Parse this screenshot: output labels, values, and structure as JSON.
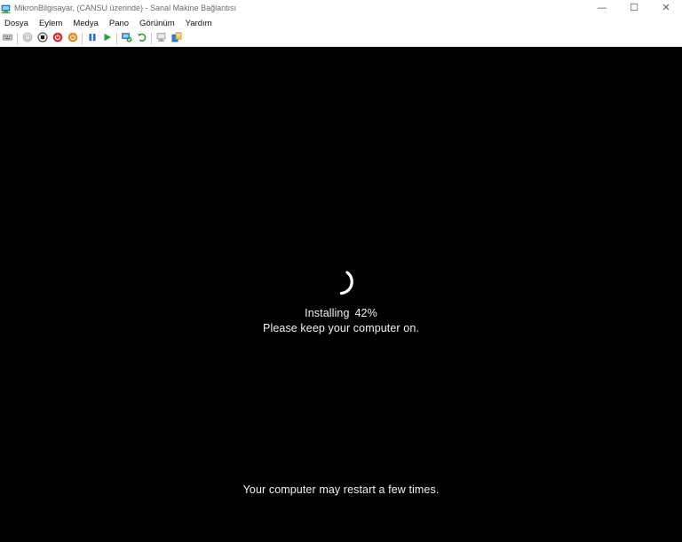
{
  "window": {
    "title": "MikronBilgisayar, (CANSU üzerinde) - Sanal Makine Bağlantısı",
    "controls": {
      "minimize": "—",
      "maximize": "☐",
      "close": "✕"
    }
  },
  "menu": {
    "items": [
      {
        "label": "Dosya"
      },
      {
        "label": "Eylem"
      },
      {
        "label": "Medya"
      },
      {
        "label": "Pano"
      },
      {
        "label": "Görünüm"
      },
      {
        "label": "Yardım"
      }
    ]
  },
  "toolbar": {
    "buttons": [
      {
        "icon": "ctrl-alt-del-icon"
      },
      {
        "icon": "start-icon"
      },
      {
        "icon": "turn-off-icon"
      },
      {
        "icon": "shut-down-icon"
      },
      {
        "icon": "save-state-icon"
      },
      {
        "icon": "pause-icon"
      },
      {
        "icon": "resume-icon"
      },
      {
        "icon": "checkpoint-icon"
      },
      {
        "icon": "revert-icon"
      },
      {
        "icon": "enhanced-session-icon"
      },
      {
        "icon": "share-icon"
      }
    ],
    "colors": {
      "red": "#d9262b",
      "orange": "#e58a1a",
      "blue": "#1f6fc2",
      "green": "#2e9e3b"
    }
  },
  "guest": {
    "installing_label": "Installing",
    "installing_percent": "42%",
    "keep_on": "Please keep your computer on.",
    "restart_note": "Your computer may restart a few times.",
    "text_color": "#f2f2f2",
    "background": "#000000"
  }
}
